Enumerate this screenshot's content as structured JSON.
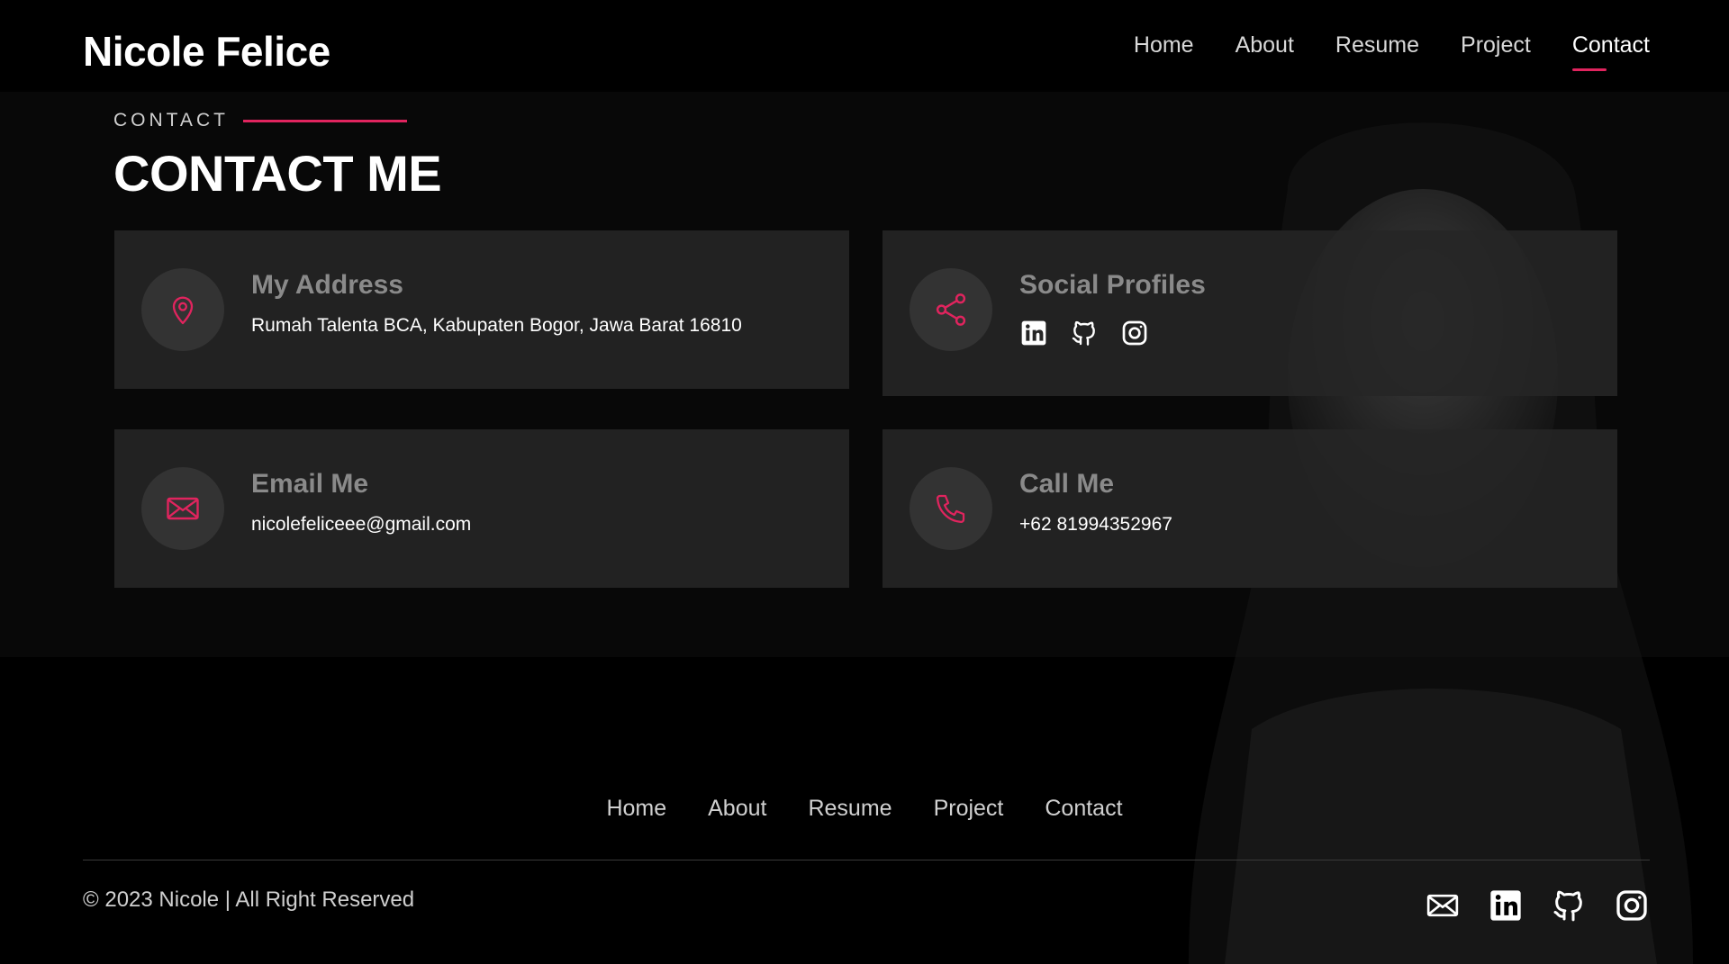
{
  "brand": "Nicole Felice",
  "nav": [
    "Home",
    "About",
    "Resume",
    "Project",
    "Contact"
  ],
  "active_nav": "Contact",
  "section": {
    "eyebrow": "CONTACT",
    "title": "CONTACT ME"
  },
  "cards": {
    "address": {
      "icon": "map-pin-icon",
      "title": "My Address",
      "text": "Rumah Talenta BCA, Kabupaten Bogor, Jawa Barat 16810"
    },
    "social": {
      "icon": "share-icon",
      "title": "Social Profiles",
      "links": [
        "linkedin-icon",
        "github-icon",
        "instagram-icon"
      ]
    },
    "email": {
      "icon": "envelope-icon",
      "title": "Email Me",
      "text": "nicolefeliceee@gmail.com"
    },
    "phone": {
      "icon": "phone-icon",
      "title": "Call Me",
      "text": "+62 81994352967"
    }
  },
  "footer": {
    "nav": [
      "Home",
      "About",
      "Resume",
      "Project",
      "Contact"
    ],
    "copyright": "© 2023 Nicole | All Right Reserved",
    "icons": [
      "envelope-icon",
      "linkedin-icon",
      "github-icon",
      "instagram-icon"
    ]
  },
  "colors": {
    "accent": "#e0245e",
    "background": "#000000",
    "card": "#262626"
  }
}
